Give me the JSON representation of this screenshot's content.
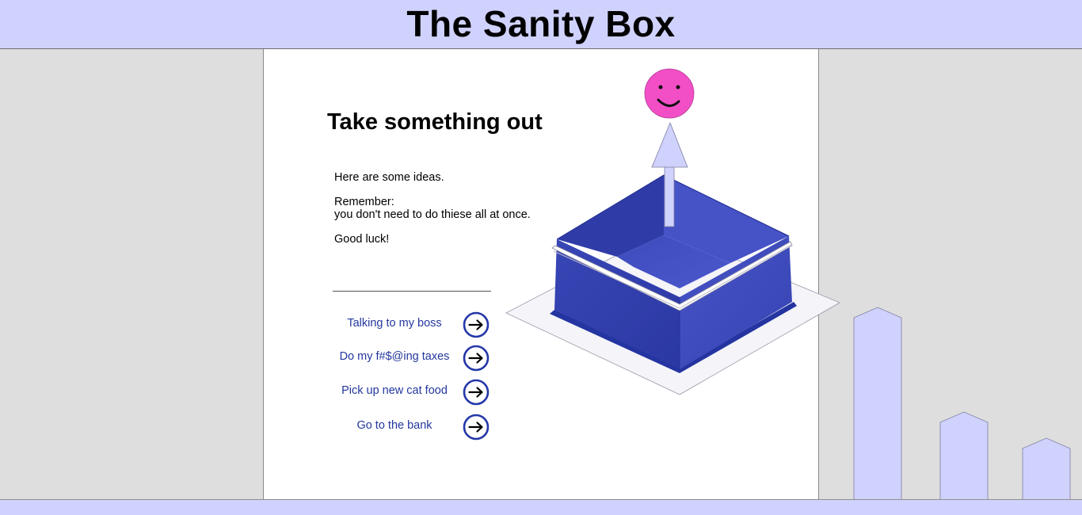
{
  "app": {
    "title": "The Sanity Box"
  },
  "main": {
    "heading": "Take something out",
    "intro": {
      "line1": "Here are some ideas.",
      "line2": "Remember:",
      "line3": "you don't need to do thiese all at once.",
      "line4": "Good luck!"
    },
    "tasks": [
      {
        "label": "Talking to my boss",
        "icon": "arrow-right-circle-icon"
      },
      {
        "label": "Do my f#$@ing taxes",
        "icon": "arrow-right-circle-icon"
      },
      {
        "label": "Pick up new cat food",
        "icon": "arrow-right-circle-icon"
      },
      {
        "label": "Go to the bank",
        "icon": "arrow-right-circle-icon"
      }
    ]
  },
  "illustration": {
    "box": "open-box-illustration",
    "arrow": "arrow-up-icon",
    "face": "smiley-face-icon"
  },
  "colors": {
    "header_bg": "#d0d2fe",
    "page_bg": "#dedede",
    "accent": "#2438a8",
    "box_blue": "#3f4cc0",
    "smiley_pink": "#f24fc6",
    "skyline": "#d0d2fe"
  }
}
